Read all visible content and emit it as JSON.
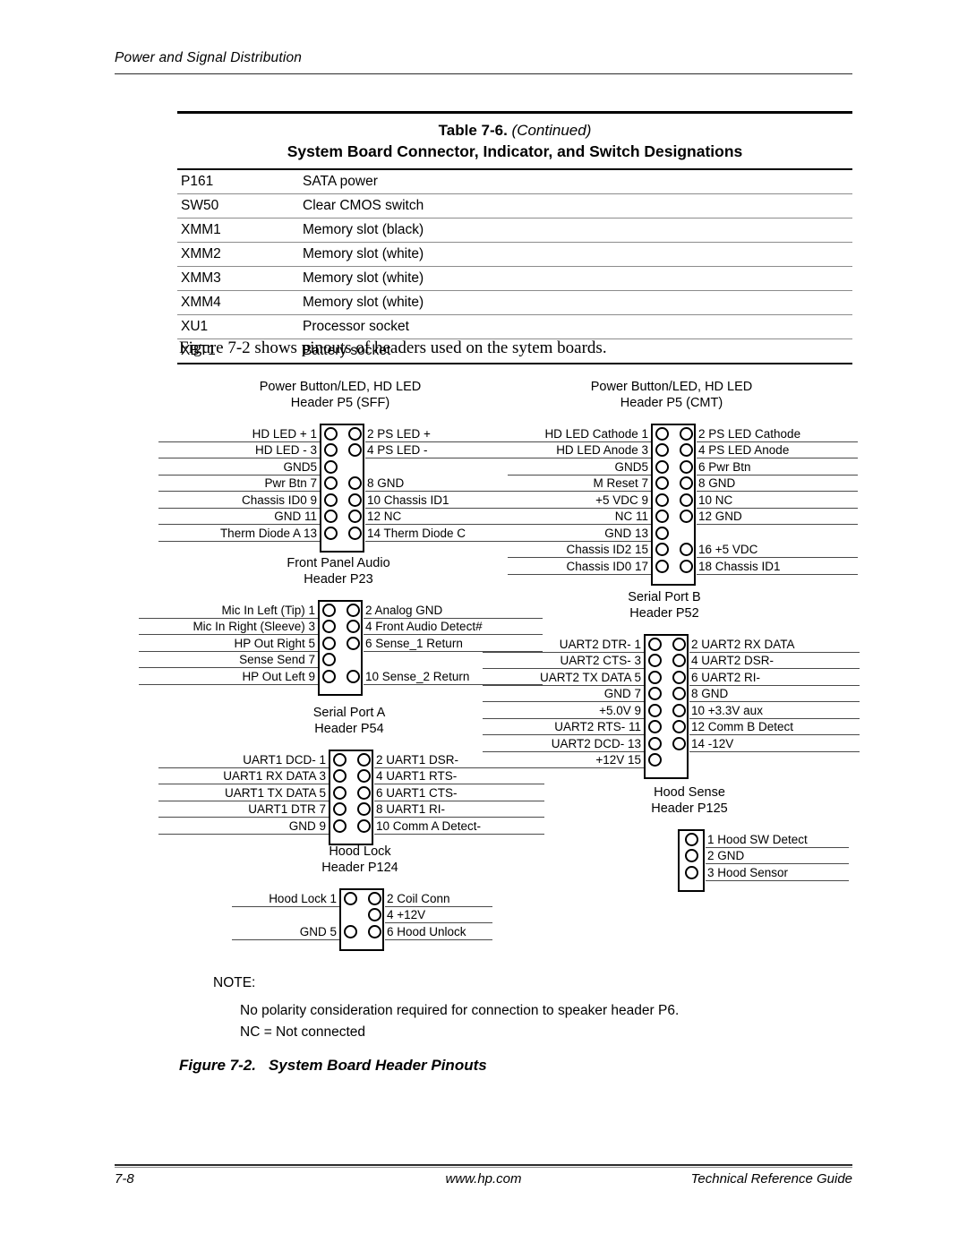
{
  "page": {
    "running_head": "Power and Signal Distribution",
    "intro_sentence": "Figure 7-2 shows pinouts of headers used on the sytem boards.",
    "figure_caption_number": "Figure 7-2.",
    "figure_caption_text": "System Board Header Pinouts"
  },
  "table": {
    "title_main": "Table 7-6.",
    "title_continued": "(Continued)",
    "subtitle": "System Board Connector, Indicator, and Switch Designations",
    "rows": [
      {
        "designator": "P161",
        "description": "SATA power"
      },
      {
        "designator": "SW50",
        "description": "Clear CMOS switch"
      },
      {
        "designator": "XMM1",
        "description": "Memory slot (black)"
      },
      {
        "designator": "XMM2",
        "description": "Memory slot (white)"
      },
      {
        "designator": "XMM3",
        "description": "Memory slot (white)"
      },
      {
        "designator": "XMM4",
        "description": "Memory slot (white)"
      },
      {
        "designator": "XU1",
        "description": "Processor socket"
      },
      {
        "designator": "XBT1",
        "description": "Battery socket"
      }
    ]
  },
  "diagrams": [
    {
      "id": "p5-sff",
      "title_line1": "Power Button/LED, HD LED",
      "title_line2": "Header P5 (SFF)",
      "rows": [
        {
          "left": "HD LED + 1",
          "right": "2 PS LED +",
          "left_pin": true,
          "right_pin": true
        },
        {
          "left": "HD LED - 3",
          "right": "4 PS LED -",
          "left_pin": true,
          "right_pin": true
        },
        {
          "left": "GND5",
          "right": "",
          "left_pin": true,
          "right_pin": false
        },
        {
          "left": "Pwr Btn 7",
          "right": "8 GND",
          "left_pin": true,
          "right_pin": true
        },
        {
          "left": "Chassis ID0 9",
          "right": "10 Chassis ID1",
          "left_pin": true,
          "right_pin": true
        },
        {
          "left": "GND 11",
          "right": "12 NC",
          "left_pin": true,
          "right_pin": true
        },
        {
          "left": "Therm Diode A 13",
          "right": "14 Therm Diode C",
          "left_pin": true,
          "right_pin": true
        }
      ]
    },
    {
      "id": "p5-cmt",
      "title_line1": "Power Button/LED, HD LED",
      "title_line2": "Header P5 (CMT)",
      "rows": [
        {
          "left": "HD LED Cathode 1",
          "right": "2 PS LED Cathode",
          "left_pin": true,
          "right_pin": true
        },
        {
          "left": "HD LED Anode 3",
          "right": "4 PS LED Anode",
          "left_pin": true,
          "right_pin": true
        },
        {
          "left": "GND5",
          "right": "6 Pwr Btn",
          "left_pin": true,
          "right_pin": true
        },
        {
          "left": "M Reset 7",
          "right": "8 GND",
          "left_pin": true,
          "right_pin": true
        },
        {
          "left": "+5 VDC 9",
          "right": "10 NC",
          "left_pin": true,
          "right_pin": true
        },
        {
          "left": "NC 11",
          "right": "12 GND",
          "left_pin": true,
          "right_pin": true
        },
        {
          "left": "GND 13",
          "right": "",
          "left_pin": true,
          "right_pin": false
        },
        {
          "left": "Chassis ID2 15",
          "right": "16 +5 VDC",
          "left_pin": true,
          "right_pin": true
        },
        {
          "left": "Chassis ID0 17",
          "right": "18 Chassis ID1",
          "left_pin": true,
          "right_pin": true
        }
      ]
    },
    {
      "id": "p23",
      "title_line1": "Front Panel Audio",
      "title_line2": "Header P23",
      "rows": [
        {
          "left": "Mic In Left (Tip) 1",
          "right": "2 Analog GND",
          "left_pin": true,
          "right_pin": true
        },
        {
          "left": "Mic In Right (Sleeve) 3",
          "right": "4 Front Audio Detect#",
          "left_pin": true,
          "right_pin": true
        },
        {
          "left": "HP Out Right 5",
          "right": "6 Sense_1 Return",
          "left_pin": true,
          "right_pin": true
        },
        {
          "left": "Sense Send 7",
          "right": "",
          "left_pin": true,
          "right_pin": false
        },
        {
          "left": "HP Out Left 9",
          "right": "10 Sense_2 Return",
          "left_pin": true,
          "right_pin": true
        }
      ]
    },
    {
      "id": "p52",
      "title_line1": "Serial Port B",
      "title_line2": "Header P52",
      "rows": [
        {
          "left": "UART2 DTR- 1",
          "right": "2 UART2 RX DATA",
          "left_pin": true,
          "right_pin": true
        },
        {
          "left": "UART2 CTS- 3",
          "right": "4 UART2 DSR-",
          "left_pin": true,
          "right_pin": true
        },
        {
          "left": "UART2 TX DATA 5",
          "right": "6 UART2 RI-",
          "left_pin": true,
          "right_pin": true
        },
        {
          "left": "GND 7",
          "right": "8 GND",
          "left_pin": true,
          "right_pin": true
        },
        {
          "left": "+5.0V 9",
          "right": "10 +3.3V aux",
          "left_pin": true,
          "right_pin": true
        },
        {
          "left": "UART2 RTS- 11",
          "right": "12 Comm B Detect",
          "left_pin": true,
          "right_pin": true
        },
        {
          "left": "UART2 DCD- 13",
          "right": "14 -12V",
          "left_pin": true,
          "right_pin": true
        },
        {
          "left": "+12V 15",
          "right": "",
          "left_pin": true,
          "right_pin": false
        }
      ]
    },
    {
      "id": "p54",
      "title_line1": "Serial Port A",
      "title_line2": "Header P54",
      "rows": [
        {
          "left": "UART1 DCD- 1",
          "right": "2 UART1 DSR-",
          "left_pin": true,
          "right_pin": true
        },
        {
          "left": "UART1 RX DATA 3",
          "right": "4 UART1 RTS-",
          "left_pin": true,
          "right_pin": true
        },
        {
          "left": "UART1 TX DATA 5",
          "right": "6 UART1 CTS-",
          "left_pin": true,
          "right_pin": true
        },
        {
          "left": "UART1 DTR 7",
          "right": "8 UART1 RI-",
          "left_pin": true,
          "right_pin": true
        },
        {
          "left": "GND 9",
          "right": "10 Comm A Detect-",
          "left_pin": true,
          "right_pin": true
        }
      ]
    },
    {
      "id": "p125",
      "title_line1": "Hood Sense",
      "title_line2": "Header P125",
      "rows": [
        {
          "left": "",
          "right": "1 Hood SW Detect",
          "left_pin": true,
          "right_pin": false
        },
        {
          "left": "",
          "right": "2 GND",
          "left_pin": true,
          "right_pin": false
        },
        {
          "left": "",
          "right": "3 Hood Sensor",
          "left_pin": true,
          "right_pin": false
        }
      ]
    },
    {
      "id": "p124",
      "title_line1": "Hood Lock",
      "title_line2": "Header P124",
      "rows": [
        {
          "left": "Hood Lock 1",
          "right": "2 Coil Conn",
          "left_pin": true,
          "right_pin": true
        },
        {
          "left": "",
          "right": "4 +12V",
          "left_pin": false,
          "right_pin": true
        },
        {
          "left": "GND 5",
          "right": "6 Hood Unlock",
          "left_pin": true,
          "right_pin": true
        }
      ]
    }
  ],
  "note": {
    "heading": "NOTE:",
    "line1": "No polarity consideration required for connection to speaker header P6.",
    "line2": "NC = Not connected"
  },
  "footer": {
    "page_number": "7-8",
    "url": "www.hp.com",
    "guide": "Technical Reference Guide"
  }
}
